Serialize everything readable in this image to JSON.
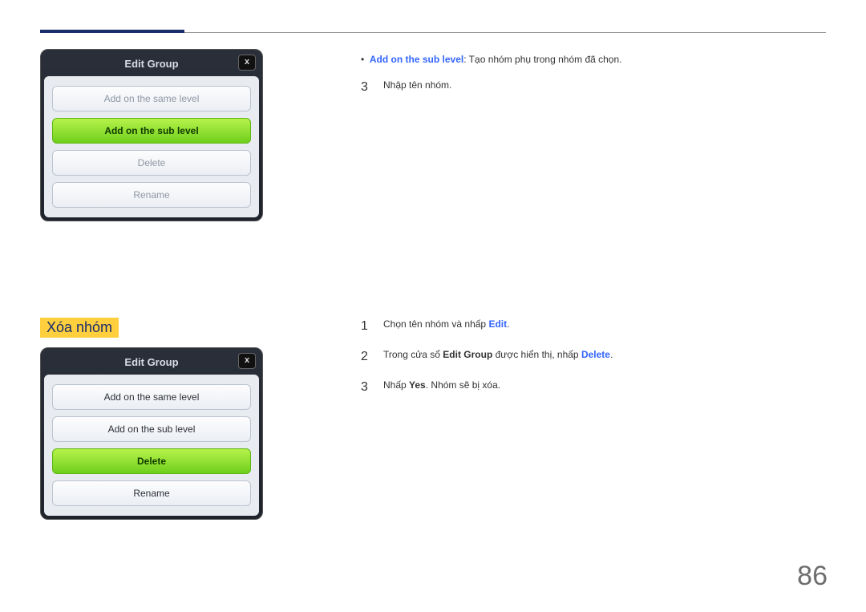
{
  "page_number": "86",
  "dialog1": {
    "title": "Edit Group",
    "close": "x",
    "options": [
      {
        "label": "Add on the same level",
        "active": false,
        "dark": false
      },
      {
        "label": "Add on the sub level",
        "active": true,
        "dark": false
      },
      {
        "label": "Delete",
        "active": false,
        "dark": false
      },
      {
        "label": "Rename",
        "active": false,
        "dark": false
      }
    ]
  },
  "section1": {
    "bullet_label": "Add on the sub level",
    "bullet_text": ": Tạo nhóm phụ trong nhóm đã chọn.",
    "step3_num": "3",
    "step3_text": "Nhập tên nhóm."
  },
  "section2": {
    "heading": "Xóa nhóm",
    "step1_num": "1",
    "step1_pre": "Chọn tên nhóm và nhấp ",
    "step1_edit": "Edit",
    "step1_post": ".",
    "step2_num": "2",
    "step2_pre": "Trong cửa sổ ",
    "step2_eg": "Edit Group",
    "step2_mid": " được hiển thị, nhấp ",
    "step2_del": "Delete",
    "step2_post": ".",
    "step3_num": "3",
    "step3_pre": "Nhấp ",
    "step3_yes": "Yes",
    "step3_post": ". Nhóm sẽ bị xóa."
  },
  "dialog2": {
    "title": "Edit Group",
    "close": "x",
    "options": [
      {
        "label": "Add on the same level",
        "active": false,
        "dark": true
      },
      {
        "label": "Add on the sub level",
        "active": false,
        "dark": true
      },
      {
        "label": "Delete",
        "active": true,
        "dark": false
      },
      {
        "label": "Rename",
        "active": false,
        "dark": true
      }
    ]
  }
}
